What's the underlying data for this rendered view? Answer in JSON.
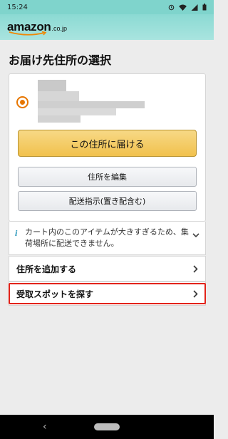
{
  "status_bar": {
    "time": "15:24",
    "icons": [
      "alarm-icon",
      "wifi-icon",
      "signal-icon",
      "battery-icon"
    ]
  },
  "header": {
    "logo_main": "amazon",
    "logo_sub": ".co.jp"
  },
  "page": {
    "title": "お届け先住所の選択"
  },
  "address_card": {
    "selected": true,
    "deliver_button": "この住所に届ける",
    "edit_button": "住所を編集",
    "delivery_instructions_button": "配送指示(置き配含む)"
  },
  "notice": {
    "icon": "info-icon",
    "text": "カート内のこのアイテムが大きすぎるため、集荷場所に配送できません。"
  },
  "rows": {
    "add_address": "住所を追加する",
    "find_pickup": "受取スポットを探す"
  },
  "colors": {
    "header_bg": "#8bdad3",
    "primary_button": "#f1c14d",
    "radio_selected": "#e77600",
    "highlight_border": "#e2231a",
    "info_icon": "#1a8fb6"
  }
}
